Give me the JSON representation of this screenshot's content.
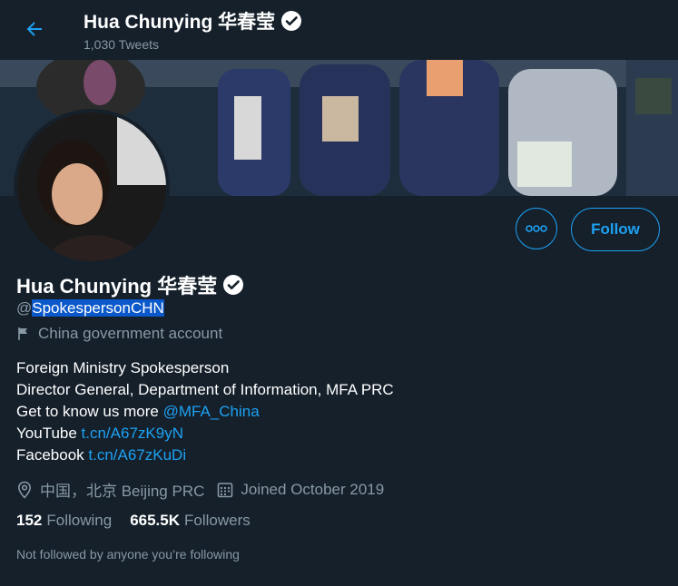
{
  "header": {
    "name": "Hua Chunying 华春莹",
    "tweet_count": "1,030 Tweets"
  },
  "profile": {
    "name": "Hua Chunying 华春莹",
    "handle_prefix": "@",
    "handle": "SpokespersonCHN",
    "label": "China government account",
    "follow_label": "Follow"
  },
  "bio": {
    "line1": "Foreign Ministry Spokesperson",
    "line2": "Director General, Department of Information, MFA PRC",
    "line3_text": "Get to know us more ",
    "line3_link": "@MFA_China",
    "line4_text": "YouTube ",
    "line4_link": "t.cn/A67zK9yN",
    "line5_text": "Facebook ",
    "line5_link": "t.cn/A67zKuDi"
  },
  "meta": {
    "location": "中国，北京 Beijing PRC",
    "joined": "Joined October 2019"
  },
  "stats": {
    "following_count": "152",
    "following_label": "Following",
    "followers_count": "665.5K",
    "followers_label": "Followers"
  },
  "not_followed": "Not followed by anyone you’re following",
  "colors": {
    "background": "#15202b",
    "accent": "#1da1f2",
    "secondary_text": "#8899a6",
    "selection": "#0a58ca"
  },
  "icons": [
    "back-arrow-icon",
    "verified-badge-icon",
    "more-icon",
    "government-flag-icon",
    "location-icon",
    "calendar-icon"
  ]
}
